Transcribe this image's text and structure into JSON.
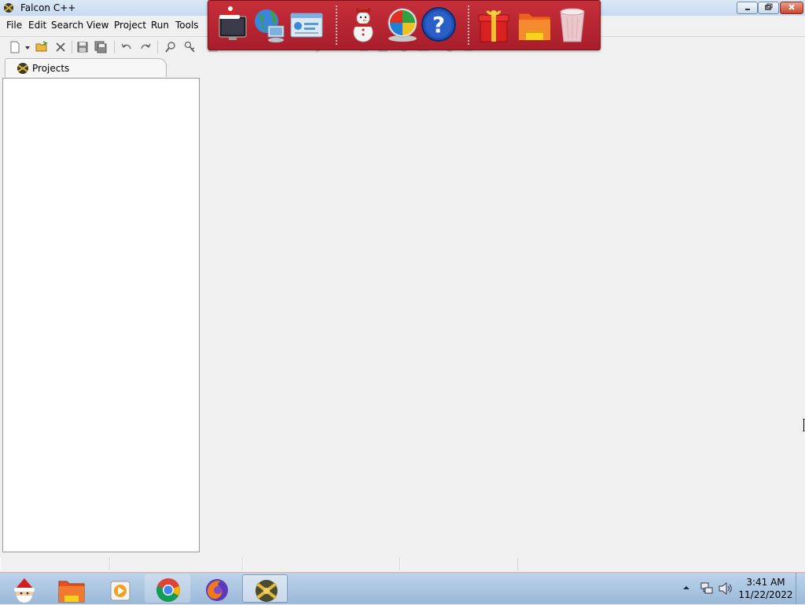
{
  "window": {
    "title": "Falcon C++",
    "icon": "falcon-logo-icon"
  },
  "menu": {
    "items": [
      "File",
      "Edit",
      "Search",
      "View",
      "Project",
      "Run",
      "Tools"
    ]
  },
  "toolbar": {
    "buttons": [
      "new-file-icon",
      "open-folder-icon",
      "close-icon",
      "save-icon",
      "save-all-icon",
      "undo-icon",
      "redo-icon",
      "find-icon",
      "find-replace-icon"
    ]
  },
  "dock": {
    "icons": [
      "santa-monitor-icon",
      "globe-network-icon",
      "control-panel-icon",
      "snowman-icon",
      "windows-logo-icon",
      "help-icon",
      "gift-icon",
      "folder-icon",
      "recycle-bin-icon"
    ],
    "colors": {
      "background": "#b22030",
      "border": "#7a1018"
    }
  },
  "projects_panel": {
    "tab_label": "Projects"
  },
  "taskbar": {
    "apps": [
      "santa-start-icon",
      "file-explorer-icon",
      "media-player-icon",
      "chrome-icon",
      "firefox-icon",
      "falcon-cpp-icon"
    ],
    "tray_icons": [
      "show-hidden-icons-icon",
      "network-icon",
      "volume-icon"
    ],
    "clock": {
      "time": "3:41 AM",
      "date": "11/22/2022"
    }
  },
  "colors": {
    "titlebar": "#c7daf0",
    "taskbar": "#a9c4e0",
    "close_button": "#c9462c",
    "window_bg": "#f0f0f0"
  }
}
